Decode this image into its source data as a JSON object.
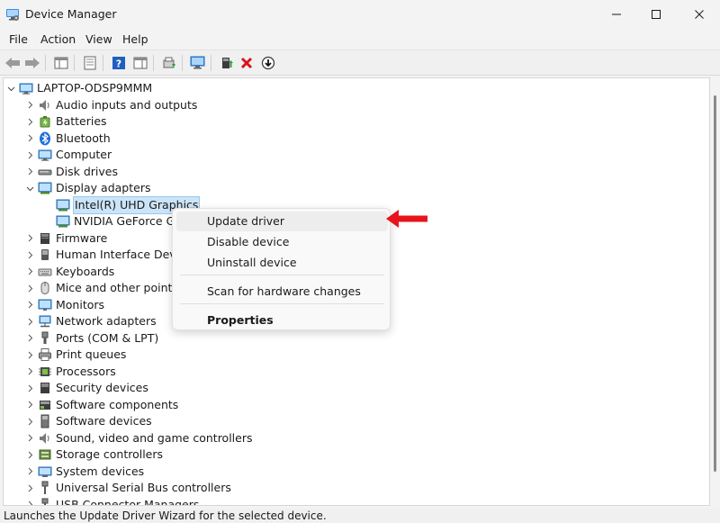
{
  "window": {
    "title": "Device Manager",
    "app_icon": "device-manager-icon"
  },
  "menubar": {
    "items": [
      "File",
      "Action",
      "View",
      "Help"
    ]
  },
  "toolbar": {
    "buttons": [
      "back-arrow-icon",
      "forward-arrow-icon",
      "show-hide-console-tree-icon",
      "properties-icon",
      "help-icon",
      "action-pane-icon",
      "update-driver-icon",
      "scan-hardware-icon",
      "add-driver-icon",
      "uninstall-device-icon",
      "disable-device-icon"
    ]
  },
  "tree": {
    "root": "LAPTOP-ODSP9MMM",
    "categories": [
      "Audio inputs and outputs",
      "Batteries",
      "Bluetooth",
      "Computer",
      "Disk drives",
      "Display adapters",
      "Firmware",
      "Human Interface Device",
      "Keyboards",
      "Mice and other pointing",
      "Monitors",
      "Network adapters",
      "Ports (COM & LPT)",
      "Print queues",
      "Processors",
      "Security devices",
      "Software components",
      "Software devices",
      "Sound, video and game controllers",
      "Storage controllers",
      "System devices",
      "Universal Serial Bus controllers",
      "USB Connector Managers"
    ],
    "display_children": [
      "Intel(R) UHD Graphics",
      "NVIDIA GeForce GTX"
    ]
  },
  "context_menu": {
    "items": [
      "Update driver",
      "Disable device",
      "Uninstall device",
      "Scan for hardware changes",
      "Properties"
    ]
  },
  "status_bar": {
    "text": "Launches the Update Driver Wizard for the selected device."
  },
  "colors": {
    "accent_arrow": "#e8141b",
    "selection": "#cce4f7"
  }
}
